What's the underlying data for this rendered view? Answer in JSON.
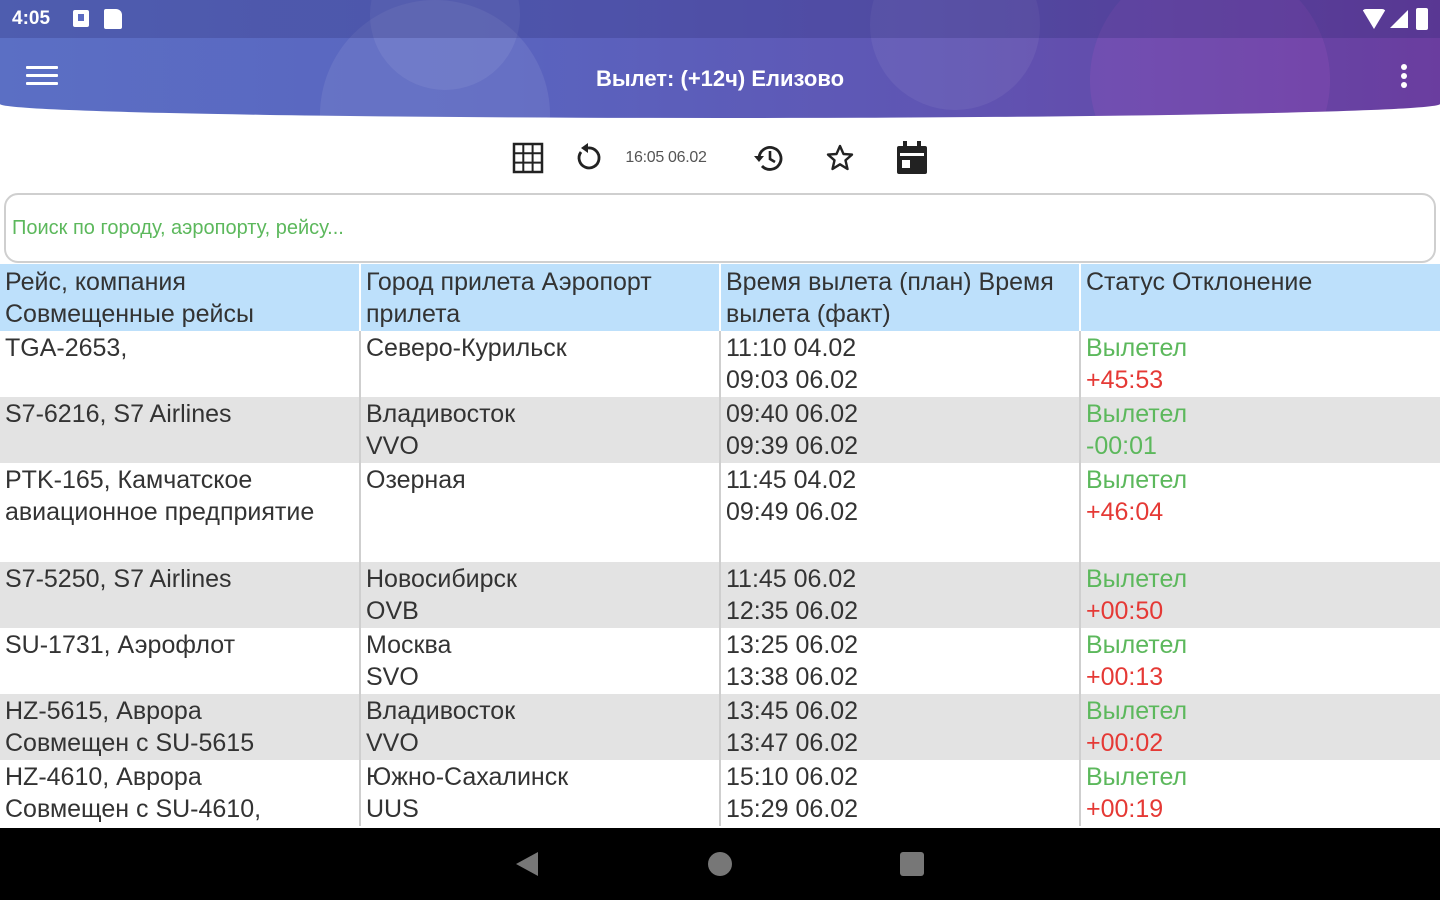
{
  "status_bar": {
    "time": "4:05"
  },
  "app_bar": {
    "title": "Вылет: (+12ч) Елизово"
  },
  "toolbar": {
    "timestamp": "16:05 06.02"
  },
  "search": {
    "placeholder": "Поиск по городу, аэропорту, рейсу..."
  },
  "table": {
    "headers": [
      {
        "line1": "Рейс, компания",
        "line2": "Совмещенные рейсы"
      },
      {
        "line1": "Город прилета",
        "line2": "Аэропорт прилета"
      },
      {
        "line1": "Время вылета (план)",
        "line2": "Время вылета (факт)"
      },
      {
        "line1": "Статус",
        "line2": "Отклонение"
      }
    ],
    "rows": [
      {
        "flight": "TGA-2653,",
        "flight2": "",
        "city": "Северо-Курильск",
        "airport": "",
        "plan": "11:10 04.02",
        "fact": "09:03 06.02",
        "status": "Вылетел",
        "delta": "+45:53",
        "delta_color": "red"
      },
      {
        "flight": "S7-6216, S7 Airlines",
        "flight2": "",
        "city": "Владивосток",
        "airport": "VVO",
        "plan": "09:40 06.02",
        "fact": "09:39 06.02",
        "status": "Вылетел",
        "delta": "-00:01",
        "delta_color": "green"
      },
      {
        "flight": "PTK-165, Камчатское",
        "flight2": "авиационное предприятие",
        "city": "Озерная",
        "airport": "",
        "plan": "11:45 04.02",
        "fact": "09:49 06.02",
        "status": "Вылетел",
        "delta": "+46:04",
        "delta_color": "red"
      },
      {
        "flight": "S7-5250, S7 Airlines",
        "flight2": "",
        "city": "Новосибирск",
        "airport": "OVB",
        "plan": "11:45 06.02",
        "fact": "12:35 06.02",
        "status": "Вылетел",
        "delta": "+00:50",
        "delta_color": "red"
      },
      {
        "flight": "SU-1731, Аэрофлот",
        "flight2": "",
        "city": "Москва",
        "airport": "SVO",
        "plan": "13:25 06.02",
        "fact": "13:38 06.02",
        "status": "Вылетел",
        "delta": "+00:13",
        "delta_color": "red"
      },
      {
        "flight": "HZ-5615, Аврора",
        "flight2": "Совмещен с SU-5615",
        "city": "Владивосток",
        "airport": "VVO",
        "plan": "13:45 06.02",
        "fact": "13:47 06.02",
        "status": "Вылетел",
        "delta": "+00:02",
        "delta_color": "red"
      },
      {
        "flight": "HZ-4610, Аврора",
        "flight2": "Совмещен с SU-4610,",
        "city": "Южно-Сахалинск",
        "airport": "UUS",
        "plan": "15:10 06.02",
        "fact": "15:29 06.02",
        "status": "Вылетел",
        "delta": "+00:19",
        "delta_color": "red"
      }
    ]
  },
  "colors": {
    "header_bg": "#bde0fb",
    "status_green": "#5cb85c",
    "delta_red": "#e53935",
    "row_alt": "#e3e3e3"
  },
  "icons": {
    "toolbar": [
      "grid-icon",
      "refresh-icon",
      "history-icon",
      "star-icon",
      "calendar-icon"
    ],
    "nav": [
      "back-icon",
      "home-icon",
      "recents-icon"
    ]
  }
}
